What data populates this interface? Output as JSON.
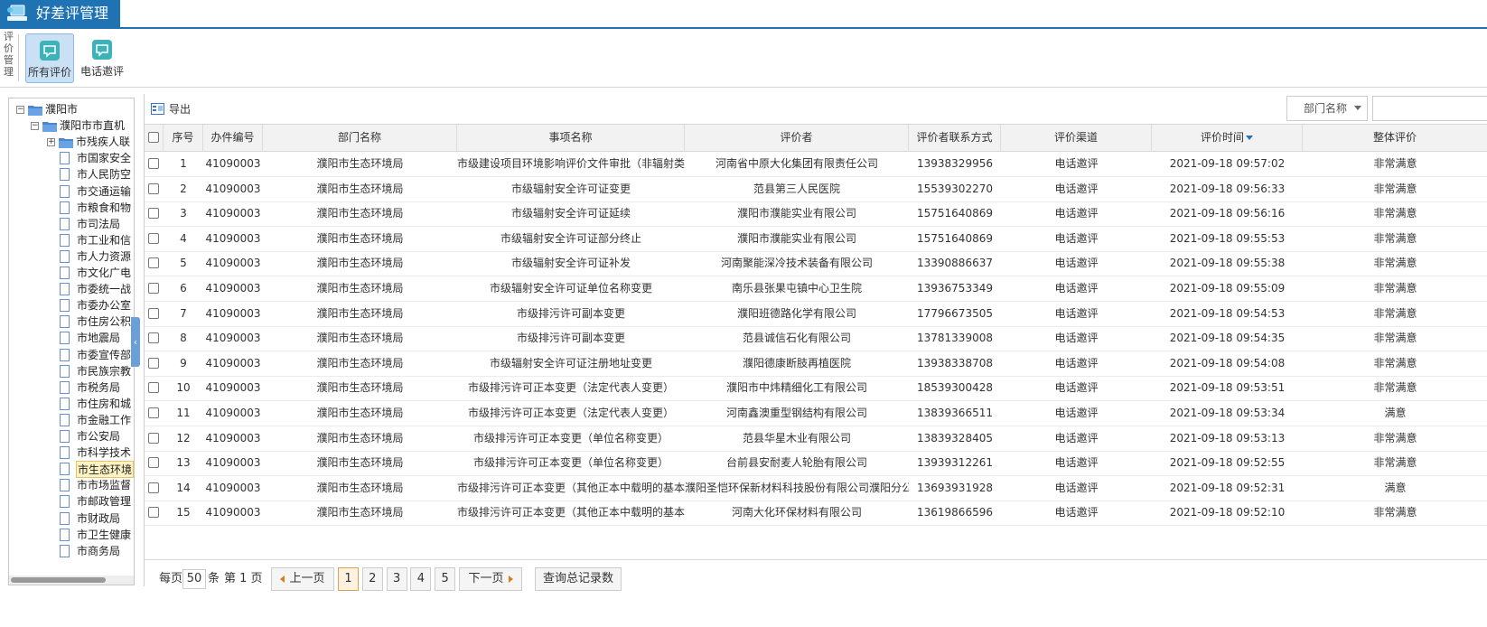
{
  "app": {
    "title": "好差评管理",
    "colors": {
      "accent": "#1f73b3",
      "selected_tab": "#c9e0f5"
    }
  },
  "toolbar": {
    "group_label": "评价管理",
    "buttons": [
      {
        "label": "所有评价",
        "icon": "chat-icon",
        "active": true
      },
      {
        "label": "电话邀评",
        "icon": "chat-icon",
        "active": false
      }
    ]
  },
  "tree": {
    "nodes": [
      {
        "label": "濮阳市",
        "level": 0,
        "type": "folder",
        "toggle": "−"
      },
      {
        "label": "濮阳市市直机",
        "level": 1,
        "type": "folder",
        "toggle": "−"
      },
      {
        "label": "市残疾人联",
        "level": 2,
        "type": "folder",
        "toggle": "+"
      },
      {
        "label": "市国家安全",
        "level": 2,
        "type": "page"
      },
      {
        "label": "市人民防空",
        "level": 2,
        "type": "page"
      },
      {
        "label": "市交通运输",
        "level": 2,
        "type": "page"
      },
      {
        "label": "市粮食和物",
        "level": 2,
        "type": "page"
      },
      {
        "label": "市司法局",
        "level": 2,
        "type": "page"
      },
      {
        "label": "市工业和信",
        "level": 2,
        "type": "page"
      },
      {
        "label": "市人力资源",
        "level": 2,
        "type": "page"
      },
      {
        "label": "市文化广电",
        "level": 2,
        "type": "page"
      },
      {
        "label": "市委统一战",
        "level": 2,
        "type": "page"
      },
      {
        "label": "市委办公室",
        "level": 2,
        "type": "page"
      },
      {
        "label": "市住房公积",
        "level": 2,
        "type": "page"
      },
      {
        "label": "市地震局",
        "level": 2,
        "type": "page"
      },
      {
        "label": "市委宣传部",
        "level": 2,
        "type": "page"
      },
      {
        "label": "市民族宗教",
        "level": 2,
        "type": "page"
      },
      {
        "label": "市税务局",
        "level": 2,
        "type": "page"
      },
      {
        "label": "市住房和城",
        "level": 2,
        "type": "page"
      },
      {
        "label": "市金融工作",
        "level": 2,
        "type": "page"
      },
      {
        "label": "市公安局",
        "level": 2,
        "type": "page"
      },
      {
        "label": "市科学技术",
        "level": 2,
        "type": "page"
      },
      {
        "label": "市生态环境",
        "level": 2,
        "type": "page",
        "selected": true
      },
      {
        "label": "市市场监督",
        "level": 2,
        "type": "page"
      },
      {
        "label": "市邮政管理",
        "level": 2,
        "type": "page"
      },
      {
        "label": "市财政局",
        "level": 2,
        "type": "page"
      },
      {
        "label": "市卫生健康",
        "level": 2,
        "type": "page"
      },
      {
        "label": "市商务局",
        "level": 2,
        "type": "page"
      }
    ]
  },
  "main": {
    "export_label": "导出",
    "filter": {
      "select_value": "部门名称",
      "input_value": ""
    },
    "columns": [
      "序号",
      "办件编号",
      "部门名称",
      "事项名称",
      "评价者",
      "评价者联系方式",
      "评价渠道",
      "评价时间",
      "整体评价"
    ],
    "rows": [
      [
        "1",
        "41090003",
        "濮阳市生态环境局",
        "市级建设项目环境影响评价文件审批（非辐射类",
        "河南省中原大化集团有限责任公司",
        "13938329956",
        "电话邀评",
        "2021-09-18 09:57:02",
        "非常满意"
      ],
      [
        "2",
        "41090003",
        "濮阳市生态环境局",
        "市级辐射安全许可证变更",
        "范县第三人民医院",
        "15539302270",
        "电话邀评",
        "2021-09-18 09:56:33",
        "非常满意"
      ],
      [
        "3",
        "41090003",
        "濮阳市生态环境局",
        "市级辐射安全许可证延续",
        "濮阳市濮能实业有限公司",
        "15751640869",
        "电话邀评",
        "2021-09-18 09:56:16",
        "非常满意"
      ],
      [
        "4",
        "41090003",
        "濮阳市生态环境局",
        "市级辐射安全许可证部分终止",
        "濮阳市濮能实业有限公司",
        "15751640869",
        "电话邀评",
        "2021-09-18 09:55:53",
        "非常满意"
      ],
      [
        "5",
        "41090003",
        "濮阳市生态环境局",
        "市级辐射安全许可证补发",
        "河南聚能深冷技术装备有限公司",
        "13390886637",
        "电话邀评",
        "2021-09-18 09:55:38",
        "非常满意"
      ],
      [
        "6",
        "41090003",
        "濮阳市生态环境局",
        "市级辐射安全许可证单位名称变更",
        "南乐县张果屯镇中心卫生院",
        "13936753349",
        "电话邀评",
        "2021-09-18 09:55:09",
        "非常满意"
      ],
      [
        "7",
        "41090003",
        "濮阳市生态环境局",
        "市级排污许可副本变更",
        "濮阳班德路化学有限公司",
        "17796673505",
        "电话邀评",
        "2021-09-18 09:54:53",
        "非常满意"
      ],
      [
        "8",
        "41090003",
        "濮阳市生态环境局",
        "市级排污许可副本变更",
        "范县诚信石化有限公司",
        "13781339008",
        "电话邀评",
        "2021-09-18 09:54:35",
        "非常满意"
      ],
      [
        "9",
        "41090003",
        "濮阳市生态环境局",
        "市级辐射安全许可证注册地址变更",
        "濮阳德康断肢再植医院",
        "13938338708",
        "电话邀评",
        "2021-09-18 09:54:08",
        "非常满意"
      ],
      [
        "10",
        "41090003",
        "濮阳市生态环境局",
        "市级排污许可正本变更（法定代表人变更）",
        "濮阳市中炜精细化工有限公司",
        "18539300428",
        "电话邀评",
        "2021-09-18 09:53:51",
        "非常满意"
      ],
      [
        "11",
        "41090003",
        "濮阳市生态环境局",
        "市级排污许可正本变更（法定代表人变更）",
        "河南鑫澳重型钢结构有限公司",
        "13839366511",
        "电话邀评",
        "2021-09-18 09:53:34",
        "满意"
      ],
      [
        "12",
        "41090003",
        "濮阳市生态环境局",
        "市级排污许可正本变更（单位名称变更）",
        "范县华星木业有限公司",
        "13839328405",
        "电话邀评",
        "2021-09-18 09:53:13",
        "非常满意"
      ],
      [
        "13",
        "41090003",
        "濮阳市生态环境局",
        "市级排污许可正本变更（单位名称变更）",
        "台前县安耐麦人轮胎有限公司",
        "13939312261",
        "电话邀评",
        "2021-09-18 09:52:55",
        "非常满意"
      ],
      [
        "14",
        "41090003",
        "濮阳市生态环境局",
        "市级排污许可正本变更（其他正本中载明的基本",
        "濮阳圣恺环保新材料科技股份有限公司濮阳分公",
        "13693931928",
        "电话邀评",
        "2021-09-18 09:52:31",
        "满意"
      ],
      [
        "15",
        "41090003",
        "濮阳市生态环境局",
        "市级排污许可正本变更（其他正本中载明的基本",
        "河南大化环保材料有限公司",
        "13619866596",
        "电话邀评",
        "2021-09-18 09:52:10",
        "非常满意"
      ]
    ]
  },
  "pager": {
    "per_page_prefix": "每页",
    "per_page_value": "50",
    "per_page_suffix": "条",
    "current_page_text": "第 1 页",
    "prev_label": "上一页",
    "next_label": "下一页",
    "pages": [
      "1",
      "2",
      "3",
      "4",
      "5"
    ],
    "current_page": "1",
    "total_query_label": "查询总记录数"
  }
}
